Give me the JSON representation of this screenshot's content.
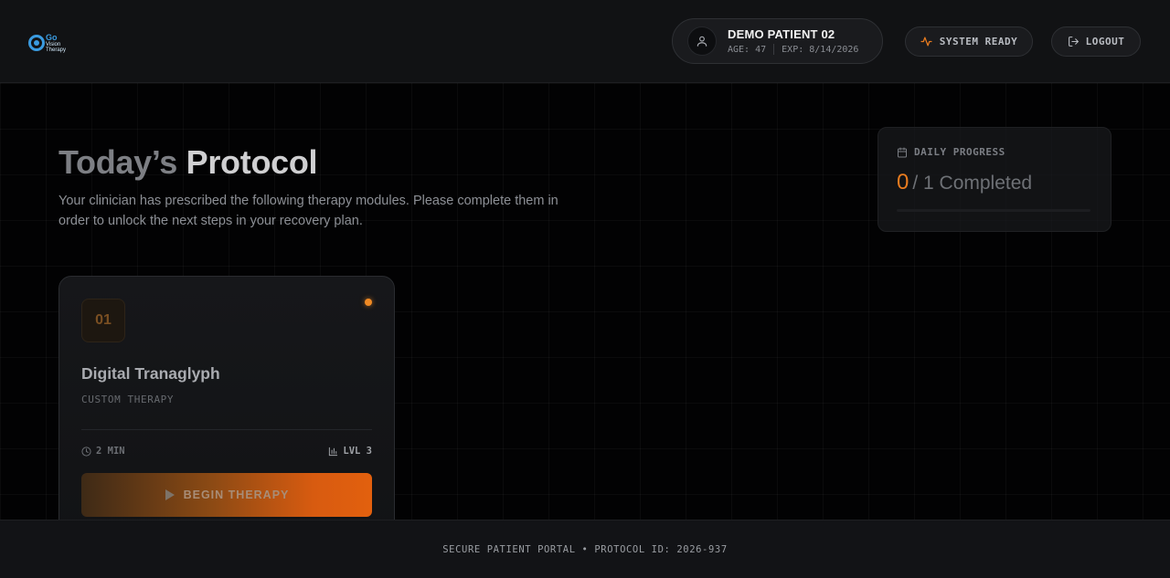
{
  "brand": {
    "logo_line1": "Go",
    "logo_line2": "Vision",
    "logo_line3": "Therapy",
    "accent": "#3a9be0"
  },
  "header": {
    "patient_name": "DEMO PATIENT 02",
    "patient_age": "AGE: 47",
    "patient_exp": "EXP: 8/14/2026",
    "status_label": "SYSTEM READY",
    "status_icon": "activity-icon",
    "logout_label": "LOGOUT",
    "logout_icon": "logout-icon",
    "avatar_icon": "user-icon"
  },
  "main": {
    "title_part1": "Today’s",
    "title_part2": "Protocol",
    "subtitle": "Your clinician has prescribed the following therapy modules. Please complete them in order to unlock the next steps in your recovery plan."
  },
  "progress": {
    "label": "DAILY PROGRESS",
    "icon": "calendar-icon",
    "completed": "0",
    "total_text": "/ 1 Completed",
    "fraction": 0
  },
  "modules": [
    {
      "number": "01",
      "title": "Digital Tranaglyph",
      "subtitle": "CUSTOM THERAPY",
      "duration": "2 MIN",
      "level": "LVL 3",
      "button_label": "BEGIN THERAPY",
      "accent": "#e2600e"
    }
  ],
  "footer": {
    "text": "SECURE PATIENT PORTAL • PROTOCOL ID: 2026-937"
  }
}
